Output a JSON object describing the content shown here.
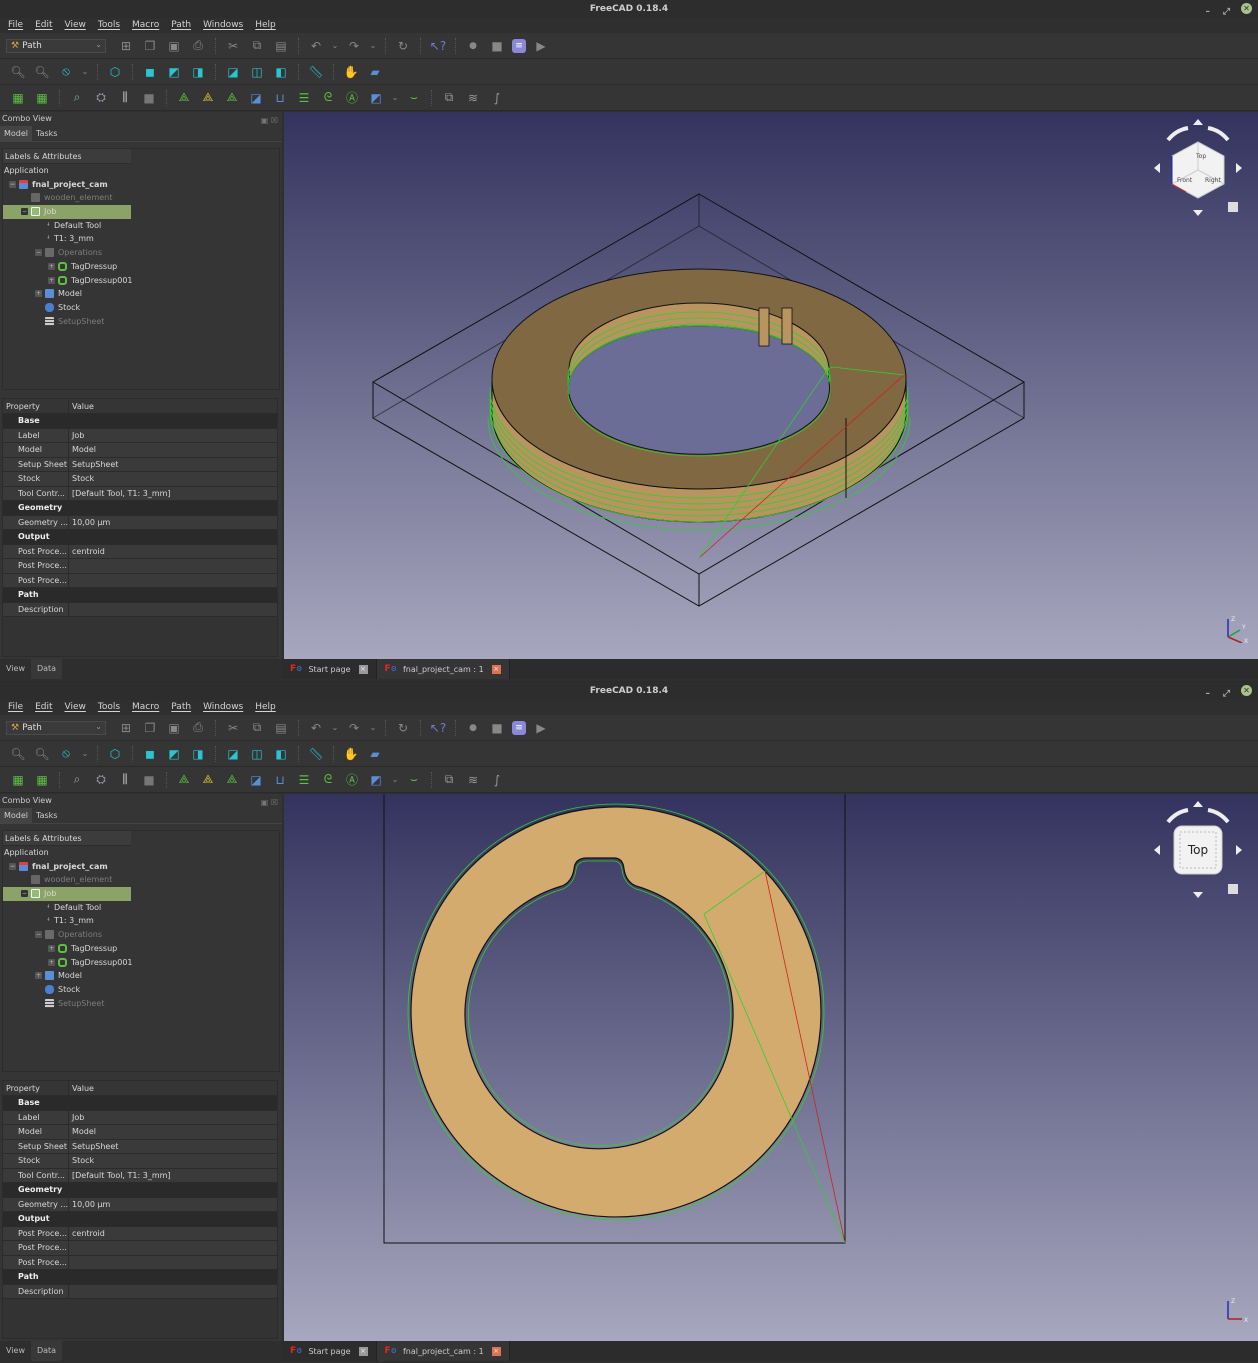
{
  "app_title": "FreeCAD 0.18.4",
  "menu": [
    "File",
    "Edit",
    "View",
    "Tools",
    "Macro",
    "Path",
    "Windows",
    "Help"
  ],
  "workbench": "Path",
  "toolbar_icons": {
    "row1": [
      "new-document-icon",
      "open-icon",
      "save-icon",
      "print-icon",
      "cut-icon",
      "copy-icon",
      "paste-icon",
      "undo-icon",
      "redo-icon",
      "refresh-icon",
      "whats-this-icon",
      "macro-record-icon",
      "macro-stop-icon",
      "macro-edit-icon",
      "macro-run-icon"
    ],
    "row2": [
      "fit-all-icon",
      "fit-selection-icon",
      "draw-style-icon",
      "isometric-view-icon",
      "front-view-icon",
      "top-view-icon",
      "right-view-icon",
      "rear-view-icon",
      "bottom-view-icon",
      "left-view-icon",
      "measure-icon",
      "std-part-icon",
      "group-icon"
    ],
    "row3": [
      "job-icon",
      "post-process-icon",
      "inspect-icon",
      "simulator-icon",
      "tool-library-icon",
      "sanity-icon",
      "profile-faces-icon",
      "profile-edges-icon",
      "pocket-icon",
      "pocket-3d-icon",
      "drilling-icon",
      "face-icon",
      "helix-icon",
      "engrave-icon",
      "adaptive-icon",
      "dressup-icon",
      "shape-icon",
      "array-icon",
      "stack-icon"
    ]
  },
  "combo_view": {
    "title": "Combo View",
    "tabs": [
      "Model",
      "Tasks"
    ],
    "tree_header": "Labels & Attributes",
    "tree": [
      {
        "label": "Application",
        "level": 0,
        "type": "root"
      },
      {
        "label": "fnal_project_cam",
        "level": 1,
        "type": "document",
        "bold": true
      },
      {
        "label": "wooden_element",
        "level": 2,
        "type": "part",
        "dim": true
      },
      {
        "label": "Job",
        "level": 2,
        "type": "job",
        "selected": true
      },
      {
        "label": "Default Tool",
        "level": 3,
        "type": "tool"
      },
      {
        "label": "T1: 3_mm",
        "level": 3,
        "type": "tool"
      },
      {
        "label": "Operations",
        "level": 3,
        "type": "operations",
        "dim": true
      },
      {
        "label": "TagDressup",
        "level": 4,
        "type": "dressup"
      },
      {
        "label": "TagDressup001",
        "level": 4,
        "type": "dressup"
      },
      {
        "label": "Model",
        "level": 3,
        "type": "folder"
      },
      {
        "label": "Stock",
        "level": 3,
        "type": "stock"
      },
      {
        "label": "SetupSheet",
        "level": 3,
        "type": "sheet",
        "dim": true
      }
    ],
    "property_header": {
      "property": "Property",
      "value": "Value"
    },
    "properties": [
      {
        "group": "Base"
      },
      {
        "key": "Label",
        "value": "Job"
      },
      {
        "key": "Model",
        "value": "Model"
      },
      {
        "key": "Setup Sheet",
        "value": "SetupSheet"
      },
      {
        "key": "Stock",
        "value": "Stock"
      },
      {
        "key": "Tool Contr...",
        "value": "[Default Tool, T1: 3_mm]"
      },
      {
        "group": "Geometry"
      },
      {
        "key": "Geometry ...",
        "value": "10,00 µm"
      },
      {
        "group": "Output"
      },
      {
        "key": "Post Proce...",
        "value": "centroid"
      },
      {
        "key": "Post Proce...",
        "value": ""
      },
      {
        "key": "Post Proce...",
        "value": ""
      },
      {
        "group": "Path"
      },
      {
        "key": "Description",
        "value": ""
      }
    ],
    "bottom_tabs": [
      "View",
      "Data"
    ]
  },
  "doc_tabs": [
    {
      "label": "Start page",
      "active": false
    },
    {
      "label": "fnal_project_cam : 1",
      "active": true
    }
  ],
  "nav_cube": {
    "window1_faces": [
      "Top",
      "Front",
      "Right"
    ],
    "window2_face": "Top"
  },
  "axis_labels": [
    "Z",
    "Y",
    "X"
  ],
  "colors": {
    "part_top": "#7f6842",
    "part_side": "#b8945e",
    "part_flat": "#d4ab6e",
    "toolpath": "#2fcf2f",
    "rapid": "#cc2222",
    "stock_edge": "#111111",
    "selection": "#8ba366"
  }
}
